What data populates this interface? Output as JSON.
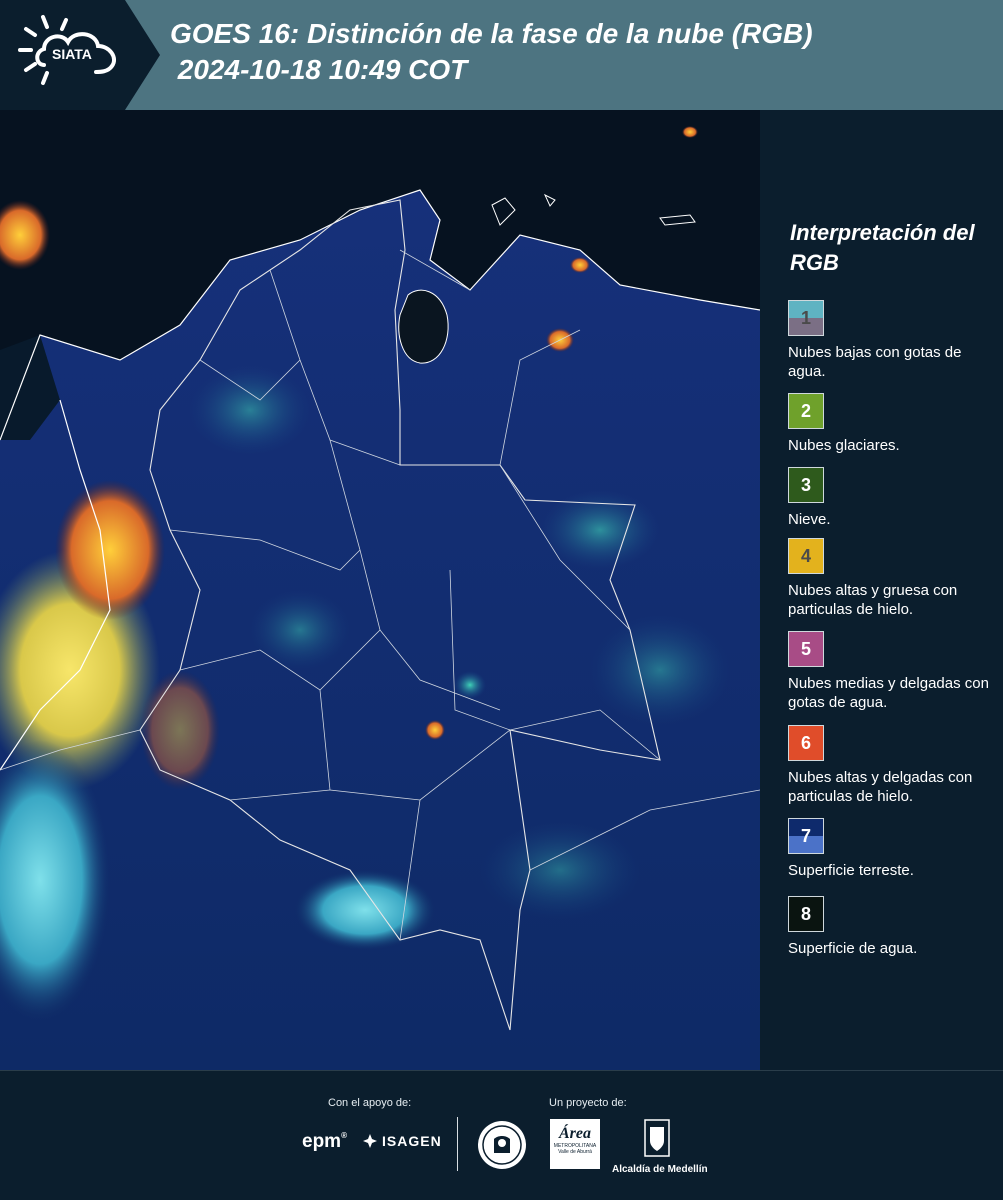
{
  "header": {
    "logo_text": "SIATA",
    "title_line1": "GOES 16: Distinción de la fase de la nube (RGB)",
    "title_line2": " 2024-10-18 10:49 COT",
    "background_color": "#4d7481"
  },
  "map": {
    "background_color": "#07102a",
    "border_color": "#ffffff"
  },
  "legend": {
    "title": "Interpretación del RGB",
    "items": [
      {
        "number": "1",
        "label": "Nubes bajas con gotas de agua.",
        "color_top": "#5fb3c2",
        "color_bottom": "#7b6f85",
        "text_color": "#4a4a4a"
      },
      {
        "number": "2",
        "label": "Nubes glaciares.",
        "color_top": "#6fa12b",
        "color_bottom": "#6fa12b",
        "text_color": "#ffffff"
      },
      {
        "number": "3",
        "label": "Nieve.",
        "color_top": "#2e5a1c",
        "color_bottom": "#2e5a1c",
        "text_color": "#ffffff"
      },
      {
        "number": "4",
        "label": "Nubes altas y gruesa con particulas de hielo.",
        "color_top": "#e3b21d",
        "color_bottom": "#e3b21d",
        "text_color": "#4a4a4a"
      },
      {
        "number": "5",
        "label": "Nubes medias y delgadas con gotas de agua.",
        "color_top": "#a84c86",
        "color_bottom": "#a84c86",
        "text_color": "#ffffff"
      },
      {
        "number": "6",
        "label": "Nubes altas y delgadas con particulas de hielo.",
        "color_top": "#e04d2a",
        "color_bottom": "#e04d2a",
        "text_color": "#ffffff"
      },
      {
        "number": "7",
        "label": "Superficie terreste.",
        "color_top": "#0e2a6c",
        "color_bottom": "#4b72c8",
        "text_color": "#ffffff"
      },
      {
        "number": "8",
        "label": "Superficie de agua.",
        "color_top": "#0a1410",
        "color_bottom": "#0a1410",
        "text_color": "#ffffff"
      }
    ]
  },
  "footer": {
    "support_label": "Con el apoyo de:",
    "project_label": "Un proyecto de:",
    "epm_text": "epm",
    "isagen_text": "ISAGEN",
    "area_text": "Área",
    "area_subtext": "METROPOLITANA",
    "area_subtext2": "Valle de Aburrá",
    "alcaldia_text": "Alcaldía de Medellín"
  }
}
